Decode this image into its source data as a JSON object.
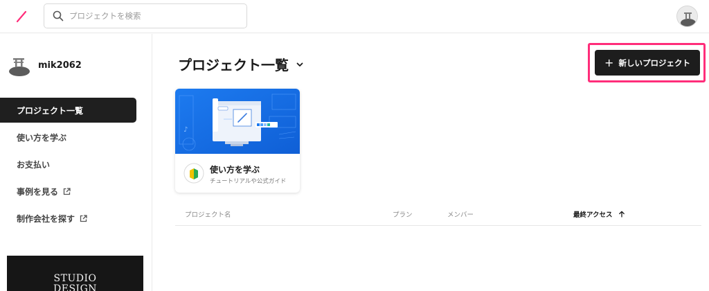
{
  "colors": {
    "brand_pink": "#ff2d7a",
    "dark": "#1d1d1d",
    "card_blue": "#1a73e8"
  },
  "header": {
    "logo_icon": "studio-slash-logo-icon",
    "search_placeholder": "プロジェクトを検索",
    "search_icon": "search-icon",
    "avatar_icon": "user-avatar"
  },
  "sidebar": {
    "username": "mik2062",
    "items": [
      {
        "label": "プロジェクト一覧",
        "active": true
      },
      {
        "label": "使い方を学ぶ"
      },
      {
        "label": "お支払い"
      },
      {
        "label": "事例を見る",
        "external": true
      },
      {
        "label": "制作会社を探す",
        "external": true
      }
    ],
    "banner_line1": "STUDIO",
    "banner_line2": "DESIGN"
  },
  "main": {
    "title": "プロジェクト一覧",
    "new_project_label": "新しいプロジェクト",
    "card": {
      "title": "使い方を学ぶ",
      "subtitle": "チュートリアルや公式ガイド"
    },
    "columns": {
      "name": "プロジェクト名",
      "plan": "プラン",
      "members": "メンバー",
      "last_access": "最終アクセス"
    }
  }
}
